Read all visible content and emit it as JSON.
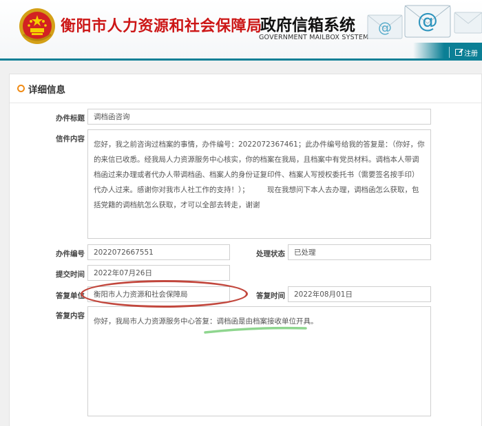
{
  "header": {
    "title_cn": "衡阳市人力资源和社会保障局",
    "title_system": "政府信箱系统",
    "title_en": "GOVERNMENT MAILBOX SYSTEM",
    "register_label": "注册",
    "accent_color": "#0b7f95",
    "brand_red": "#cc1616"
  },
  "panel": {
    "title": "详细信息",
    "fields": {
      "subject_label": "办件标题",
      "subject_value": "调档函咨询",
      "content_label": "信件内容",
      "content_value": "您好，我之前咨询过档案的事情，办件编号：2022072367461；此办件编号给我的答复是：（你好，你的来信已收悉。经我局人力资源服务中心核实，你的档案在我局，且档案中有党员材料。调档本人带调档函过来办理或者代办人带调档函、档案人的身份证复印件、档案人写授权委托书（需要签名按手印）代办人过来。感谢你对我市人社工作的支持！）；　　　现在我想问下本人去办理，调档函怎么获取，包括党籍的调档航怎么获取，才可以全部去转走，谢谢",
      "case_no_label": "办件编号",
      "case_no_value": "2022072667551",
      "status_label": "处理状态",
      "status_value": "已处理",
      "submit_time_label": "提交时间",
      "submit_time_value": "2022年07月26日",
      "reply_unit_label": "答复单位",
      "reply_unit_value": "衡阳市人力资源和社会保障局",
      "reply_time_label": "答复时间",
      "reply_time_value": "2022年08月01日",
      "reply_content_label": "答复内容",
      "reply_content_value": "你好，我局市人力资源服务中心答复：调档函是由档案接收单位开具。"
    }
  }
}
